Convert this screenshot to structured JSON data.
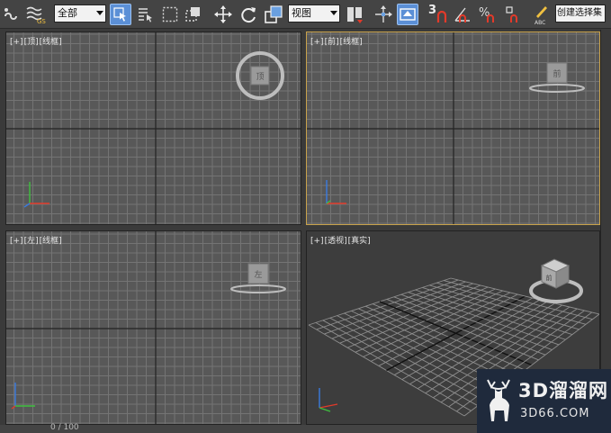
{
  "toolbar": {
    "selection_filter": "全部",
    "reference_coord": "视图",
    "snap_number": "3",
    "named_selection": "创建选择集"
  },
  "viewports": {
    "top": {
      "plus": "[+]",
      "name": "[顶]",
      "shading": "[线框]",
      "cube_label": "顶"
    },
    "front": {
      "plus": "[+]",
      "name": "[前]",
      "shading": "[线框]",
      "cube_label": "前"
    },
    "left": {
      "plus": "[+]",
      "name": "[左]",
      "shading": "[线框]",
      "cube_label": "左"
    },
    "perspective": {
      "plus": "[+]",
      "name": "[透视]",
      "shading": "[真实]",
      "cube_label": "前"
    }
  },
  "timeline": {
    "counter": "0 / 100"
  },
  "watermark": {
    "title": "3D溜溜网",
    "url": "3D66.COM"
  },
  "colors": {
    "active_border": "#c8a24a",
    "toolbar_active": "#5b8fd6",
    "axis_x": "#e23a2a",
    "axis_y": "#3fbf3f",
    "axis_z": "#3a7be0"
  }
}
